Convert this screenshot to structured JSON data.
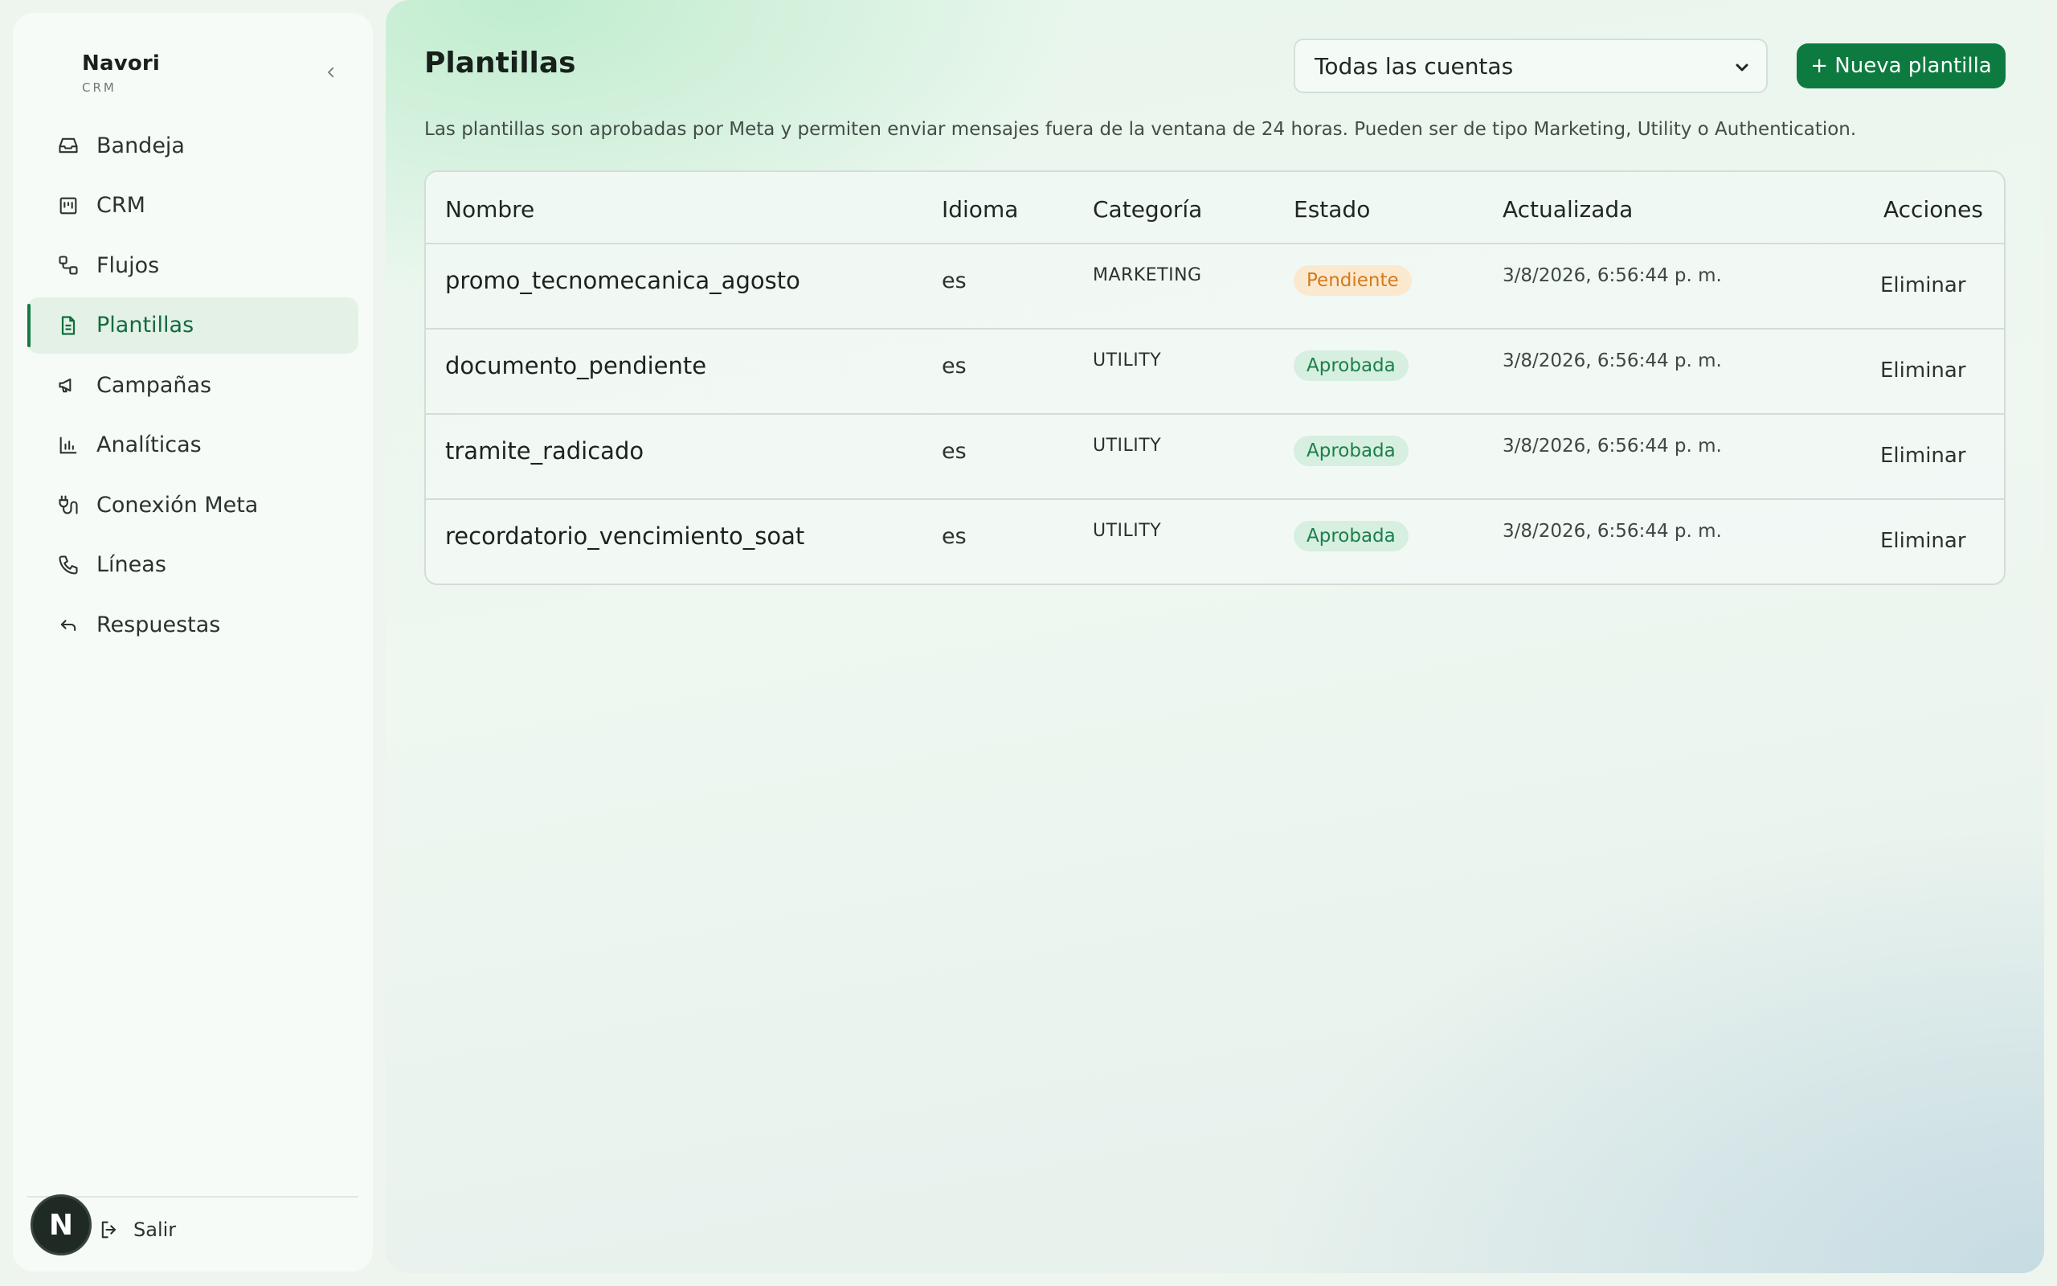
{
  "brand": {
    "name": "Navori",
    "subtitle": "CRM"
  },
  "sidebar": {
    "items": [
      {
        "label": "Bandeja",
        "icon": "inbox-icon",
        "active": false
      },
      {
        "label": "CRM",
        "icon": "kanban-icon",
        "active": false
      },
      {
        "label": "Flujos",
        "icon": "workflow-icon",
        "active": false
      },
      {
        "label": "Plantillas",
        "icon": "file-text-icon",
        "active": true
      },
      {
        "label": "Campañas",
        "icon": "megaphone-icon",
        "active": false
      },
      {
        "label": "Analíticas",
        "icon": "bar-chart-icon",
        "active": false
      },
      {
        "label": "Conexión Meta",
        "icon": "plug-icon",
        "active": false
      },
      {
        "label": "Líneas",
        "icon": "phone-icon",
        "active": false
      },
      {
        "label": "Respuestas",
        "icon": "reply-icon",
        "active": false
      }
    ],
    "avatar_initial": "N",
    "logout_label": "Salir"
  },
  "header": {
    "title": "Plantillas",
    "account_select": {
      "value": "Todas las cuentas"
    },
    "new_button": "+ Nueva plantilla"
  },
  "description": "Las plantillas son aprobadas por Meta y permiten enviar mensajes fuera de la ventana de 24 horas. Pueden ser de tipo Marketing, Utility o Authentication.",
  "table": {
    "columns": [
      "Nombre",
      "Idioma",
      "Categoría",
      "Estado",
      "Actualizada",
      "Acciones"
    ],
    "rows": [
      {
        "name": "promo_tecnomecanica_agosto",
        "language": "es",
        "category": "MARKETING",
        "status": "Pendiente",
        "updated": "3/8/2026, 6:56:44 p. m.",
        "action": "Eliminar"
      },
      {
        "name": "documento_pendiente",
        "language": "es",
        "category": "UTILITY",
        "status": "Aprobada",
        "updated": "3/8/2026, 6:56:44 p. m.",
        "action": "Eliminar"
      },
      {
        "name": "tramite_radicado",
        "language": "es",
        "category": "UTILITY",
        "status": "Aprobada",
        "updated": "3/8/2026, 6:56:44 p. m.",
        "action": "Eliminar"
      },
      {
        "name": "recordatorio_vencimiento_soat",
        "language": "es",
        "category": "UTILITY",
        "status": "Aprobada",
        "updated": "3/8/2026, 6:56:44 p. m.",
        "action": "Eliminar"
      }
    ]
  },
  "colors": {
    "accent": "#0d7a40",
    "pending": "#d47a1c",
    "approved": "#1c7f4a"
  }
}
